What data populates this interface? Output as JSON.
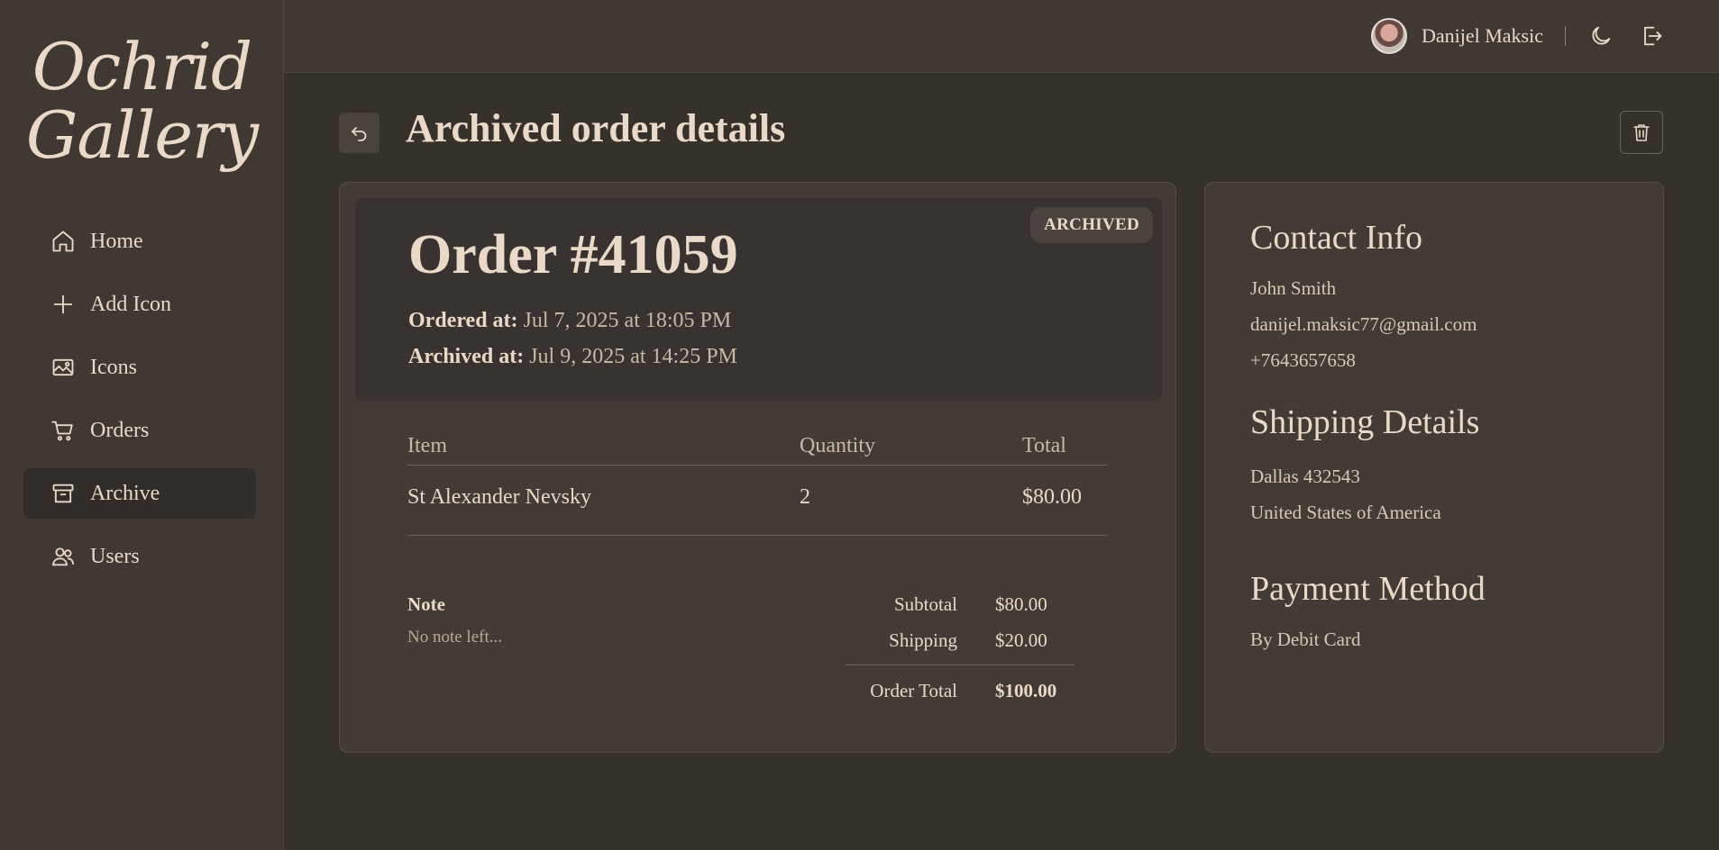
{
  "app": {
    "logo_line1": "Ochrid",
    "logo_line2": "Gallery"
  },
  "sidebar": {
    "items": [
      {
        "label": "Home",
        "icon": "home-icon"
      },
      {
        "label": "Add Icon",
        "icon": "plus-icon"
      },
      {
        "label": "Icons",
        "icon": "image-icon"
      },
      {
        "label": "Orders",
        "icon": "cart-icon"
      },
      {
        "label": "Archive",
        "icon": "archive-icon",
        "active": true
      },
      {
        "label": "Users",
        "icon": "users-icon"
      }
    ]
  },
  "header": {
    "user_name": "Danijel Maksic"
  },
  "page": {
    "title": "Archived order details"
  },
  "order": {
    "status_badge": "ARCHIVED",
    "number": "Order #41059",
    "ordered_label": "Ordered at:",
    "ordered_value": "Jul 7, 2025 at 18:05 PM",
    "archived_label": "Archived at:",
    "archived_value": "Jul 9, 2025 at 14:25 PM",
    "columns": [
      "Item",
      "Quantity",
      "Total"
    ],
    "items": [
      {
        "name": "St Alexander Nevsky",
        "quantity": "2",
        "total": "$80.00"
      }
    ],
    "note_label": "Note",
    "note_text": "No note left...",
    "subtotal_label": "Subtotal",
    "subtotal_value": "$80.00",
    "shipping_label": "Shipping",
    "shipping_value": "$20.00",
    "total_label": "Order Total",
    "total_value": "$100.00"
  },
  "contact": {
    "heading": "Contact Info",
    "name": "John Smith",
    "email": "danijel.maksic77@gmail.com",
    "phone": "+7643657658"
  },
  "shipping": {
    "heading": "Shipping Details",
    "city": "Dallas 432543",
    "country": "United States of America"
  },
  "payment": {
    "heading": "Payment Method",
    "method": "By Debit Card"
  },
  "colors": {
    "background": "#37312c",
    "panel": "#433c36",
    "text": "#e8d9c8"
  }
}
